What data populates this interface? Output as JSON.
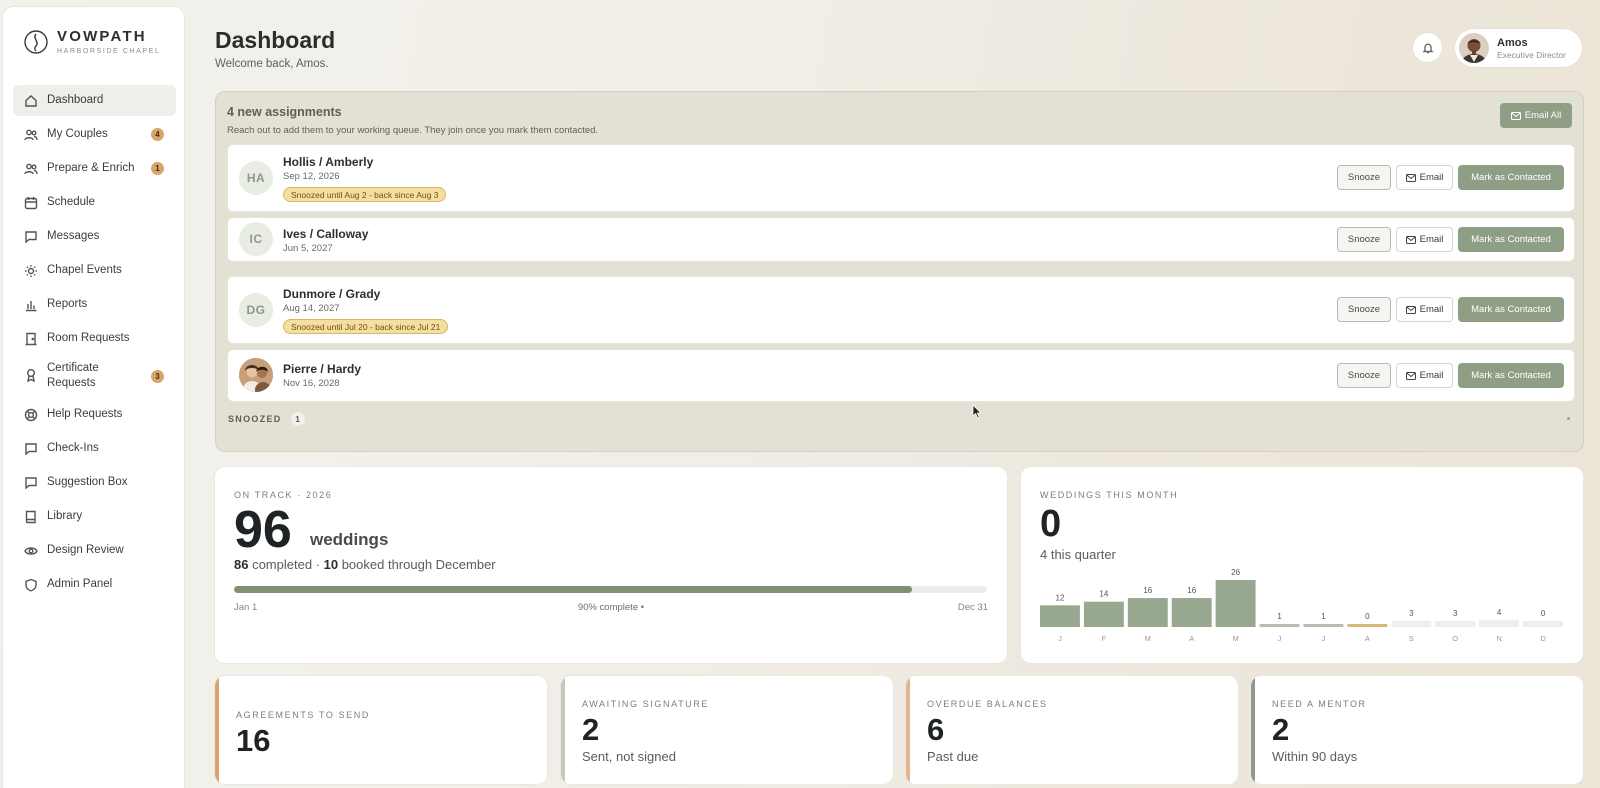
{
  "brand": {
    "name": "VOWPATH",
    "subtitle": "HARBORSIDE CHAPEL"
  },
  "sidebar": {
    "items": [
      {
        "label": "Dashboard",
        "icon": "home-icon",
        "active": true
      },
      {
        "label": "My Couples",
        "icon": "users-icon",
        "badge": "4"
      },
      {
        "label": "Prepare & Enrich",
        "icon": "users-icon",
        "badge": "1"
      },
      {
        "label": "Schedule",
        "icon": "calendar-icon"
      },
      {
        "label": "Messages",
        "icon": "message-icon"
      },
      {
        "label": "Chapel Events",
        "icon": "sun-icon"
      },
      {
        "label": "Reports",
        "icon": "bar-chart-icon"
      },
      {
        "label": "Room Requests",
        "icon": "door-icon"
      },
      {
        "label": "Certificate",
        "label2": "Requests",
        "icon": "award-icon",
        "badge": "3"
      },
      {
        "label": "Help Requests",
        "icon": "lifebuoy-icon"
      },
      {
        "label": "Check-Ins",
        "icon": "message-icon"
      },
      {
        "label": "Suggestion Box",
        "icon": "message-icon"
      },
      {
        "label": "Library",
        "icon": "book-icon"
      },
      {
        "label": "Design Review",
        "icon": "eye-icon"
      },
      {
        "label": "Admin Panel",
        "icon": "shield-icon"
      }
    ]
  },
  "header": {
    "title": "Dashboard",
    "subtitle": "Welcome back, Amos."
  },
  "user": {
    "name": "Amos",
    "role": "Executive Director"
  },
  "assignments": {
    "title": "4 new assignments",
    "subtitle": "Reach out to add them to your working queue. They join once you mark them contacted.",
    "email_all": "Email All",
    "snooze_label": "Snooze",
    "email_label": "Email",
    "contacted_label": "Mark as Contacted",
    "rows": [
      {
        "initials": "HA",
        "name": "Hollis / Amberly",
        "date": "Sep 12, 2026",
        "tag": "Snoozed until Aug 2 - back since Aug 3"
      },
      {
        "initials": "IC",
        "name": "Ives / Calloway",
        "date": "Jun 5, 2027",
        "tag": ""
      },
      {
        "initials": "DG",
        "name": "Dunmore / Grady",
        "date": "Aug 14, 2027",
        "tag": "Snoozed until Jul 20 - back since Jul 21"
      },
      {
        "initials": "",
        "name": "Pierre / Hardy",
        "date": "Nov 16, 2028",
        "tag": "",
        "photo": true
      }
    ],
    "snoozed_label": "SNOOZED",
    "snoozed_count": "1"
  },
  "on_track": {
    "eyebrow": "ON TRACK · 2026",
    "value": "96",
    "unit": "weddings",
    "completed": "86",
    "completed_label": " completed · ",
    "booked": "10",
    "booked_label": " booked through December",
    "progress": 0.9,
    "start_label": "Jan 1",
    "mid_label": "90% complete •",
    "end_label": "Dec 31"
  },
  "weddings": {
    "eyebrow": "WEDDINGS THIS MONTH",
    "value": "0",
    "subtitle": "4 this quarter"
  },
  "chart_data": {
    "type": "bar",
    "categories": [
      "J",
      "F",
      "M",
      "A",
      "M",
      "J",
      "J",
      "A",
      "S",
      "O",
      "N",
      "D"
    ],
    "values": [
      12,
      14,
      16,
      16,
      26,
      1,
      1,
      0,
      3,
      3,
      4,
      0
    ],
    "title": "",
    "xlabel": "",
    "ylabel": "",
    "colors": {
      "past": "#98a890",
      "current": "#d9b77a",
      "future": "#eeeeec",
      "low": "#b6bdb1"
    }
  },
  "stats": [
    {
      "eyebrow": "AGREEMENTS TO SEND",
      "value": "16",
      "sub": "",
      "accent": "#d9a56c"
    },
    {
      "eyebrow": "AWAITING SIGNATURE",
      "value": "2",
      "sub": "Sent, not signed",
      "accent": "#c9c8c0"
    },
    {
      "eyebrow": "OVERDUE BALANCES",
      "value": "6",
      "sub": "Past due",
      "accent": "#e2b48f"
    },
    {
      "eyebrow": "NEED A MENTOR",
      "value": "2",
      "sub": "Within 90 days",
      "accent": "#8f9994"
    }
  ],
  "colors": {
    "accent": "#8f9f86",
    "badge": "#d9a56c",
    "tag": "#f4df9e"
  }
}
